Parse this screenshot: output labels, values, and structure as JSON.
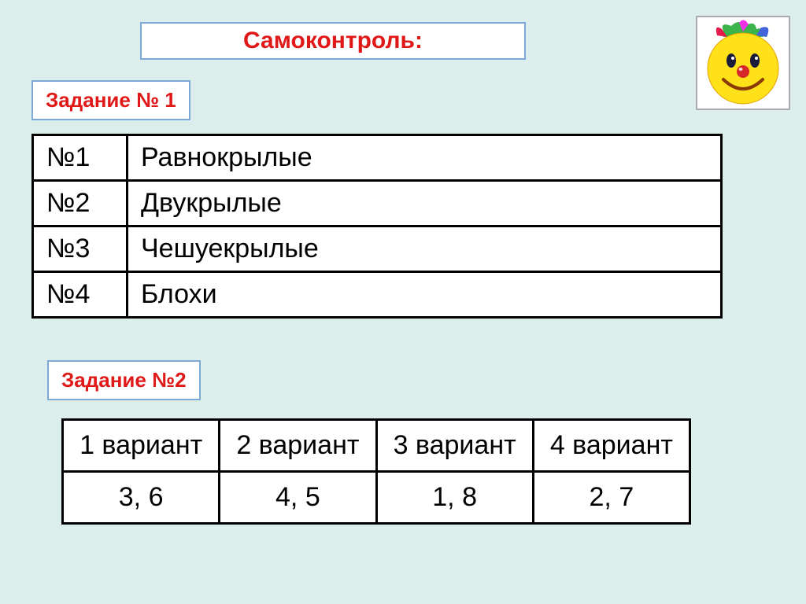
{
  "title": "Самоконтроль:",
  "task1": {
    "label": "Задание № 1",
    "rows": [
      {
        "num": "№1",
        "name": "Равнокрылые"
      },
      {
        "num": "№2",
        "name": "Двукрылые"
      },
      {
        "num": "№3",
        "name": "Чешуекрылые"
      },
      {
        "num": "№4",
        "name": "Блохи"
      }
    ]
  },
  "task2": {
    "label": "Задание №2",
    "headers": [
      "1 вариант",
      "2 вариант",
      "3 вариант",
      "4 вариант"
    ],
    "values": [
      "3, 6",
      "4, 5",
      "1, 8",
      "2, 7"
    ]
  }
}
